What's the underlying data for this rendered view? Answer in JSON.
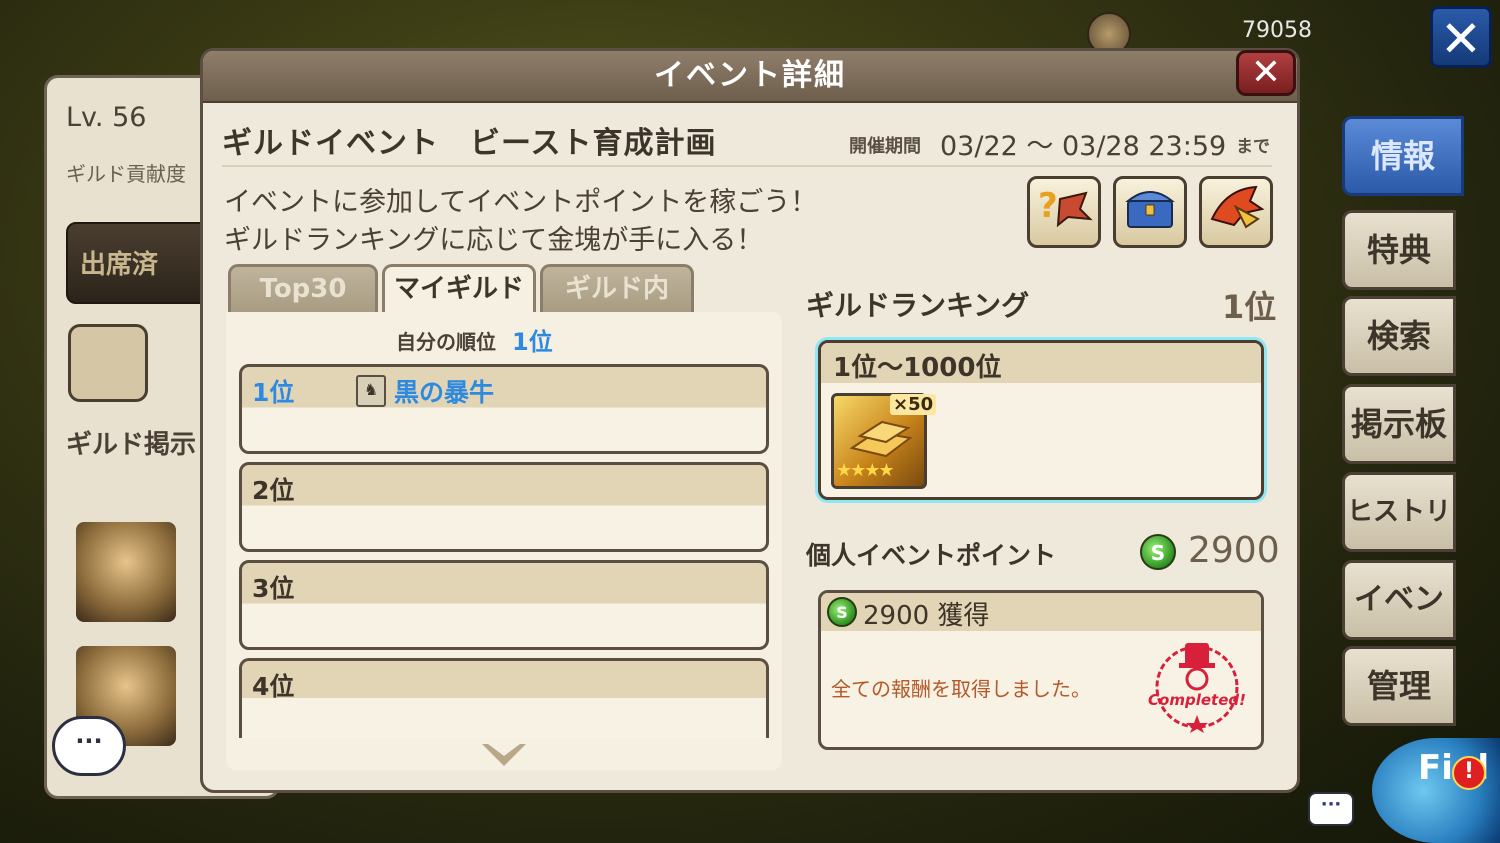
{
  "top_bar": {
    "currency_value": "79058",
    "close_icon": "✕"
  },
  "guild_panel": {
    "level": "Lv. 56",
    "contribution_label": "ギルド貢献度",
    "attend_label": "出席済",
    "board_label": "ギルド掲示",
    "chat_label": "···"
  },
  "side_menu": [
    {
      "label": "情報",
      "active": true
    },
    {
      "label": "特典"
    },
    {
      "label": "検索"
    },
    {
      "label": "掲示板"
    },
    {
      "label": "ヒストリー"
    },
    {
      "label": "イベント"
    },
    {
      "label": "管理"
    }
  ],
  "field_button": {
    "label": "Fi d",
    "alert": "!"
  },
  "mini_chat": "···",
  "modal": {
    "title": "イベント詳細",
    "close_icon": "✕",
    "event_title": "ギルドイベント　ビースト育成計画",
    "period_label": "開催期間",
    "period_value": "03/22 ～ 03/28 23:59",
    "period_suffix": "まで",
    "description_lines": [
      "イベントに参加してイベントポイントを稼ごう！",
      "ギルドランキングに応じて金塊が手に入る！"
    ],
    "icon_buttons": [
      "help-beast-icon",
      "treasure-chest-icon",
      "beast-horn-icon"
    ],
    "tabs": [
      {
        "label": "Top30",
        "active": false
      },
      {
        "label": "マイギルド",
        "active": true
      },
      {
        "label": "ギルド内",
        "active": false
      }
    ],
    "my_rank_label": "自分の順位",
    "my_rank_value": "1位",
    "rank_list": [
      {
        "rank": "1位",
        "guild_name": "黒の暴牛"
      },
      {
        "rank": "2位",
        "guild_name": ""
      },
      {
        "rank": "3位",
        "guild_name": ""
      },
      {
        "rank": "4位",
        "guild_name": ""
      }
    ],
    "guild_ranking": {
      "label": "ギルドランキング",
      "value": "1位",
      "reward_range": "1位～1000位",
      "reward_item": {
        "name": "gold-bar-icon",
        "quantity": "×50",
        "stars": "★★★★"
      }
    },
    "personal_points": {
      "label": "個人イベントポイント",
      "value": "2900",
      "card_points": "2900 獲得",
      "claimed_text": "全ての報酬を取得しました。",
      "stamp_text": "Completed!"
    }
  },
  "colors": {
    "accent_blue": "#2e8ae0",
    "header_brown": "#7e6e5c",
    "active_menu": "#3a6ac0"
  }
}
